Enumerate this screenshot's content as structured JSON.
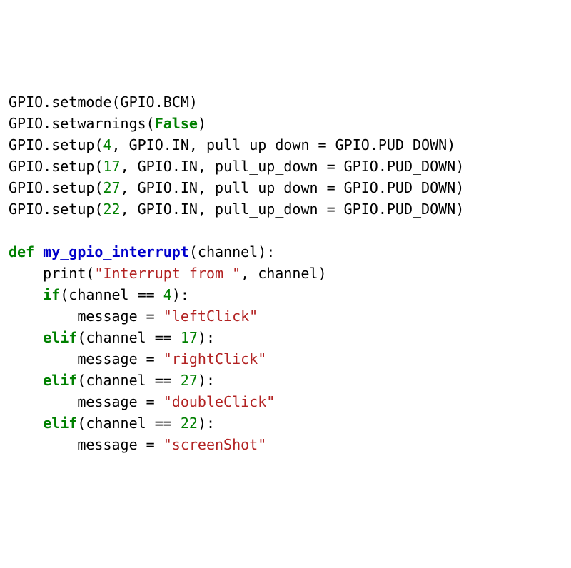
{
  "code": {
    "l1_gpio": "GPIO",
    "l1_dot1": ".",
    "l1_setmode": "setmode",
    "l1_par": "(GPIO",
    "l1_dot2": ".",
    "l1_bcm": "BCM)",
    "l2_gpio": "GPIO",
    "l2_dot1": ".",
    "l2_setwarnings": "setwarnings",
    "l2_open": "(",
    "l2_false": "False",
    "l2_close": ")",
    "setup_prefix": "GPIO",
    "setup_dot": ".",
    "setup_fn": "setup",
    "setup_open": "(",
    "setup_mid": ", GPIO",
    "setup_dot2": ".",
    "setup_in": "IN, pull_up_down = GPIO",
    "setup_dot3": ".",
    "setup_pud": "PUD_DOWN)",
    "pin4": "4",
    "pin17": "17",
    "pin27": "27",
    "pin22": "22",
    "blank": "",
    "def_kw": "def",
    "def_sp": " ",
    "def_name": "my_gpio_interrupt",
    "def_args": "(channel):",
    "ind1": "    ",
    "ind2": "        ",
    "print_call": "print",
    "print_open": "(",
    "print_str": "\"Interrupt from \"",
    "print_rest": ", channel)",
    "if_kw": "if",
    "elif_kw": "elif",
    "cond_open": "(channel == ",
    "cond_close": "):",
    "assign": "message = ",
    "str_left": "\"leftClick\"",
    "str_right": "\"rightClick\"",
    "str_double": "\"doubleClick\"",
    "str_screen": "\"screenShot\""
  }
}
